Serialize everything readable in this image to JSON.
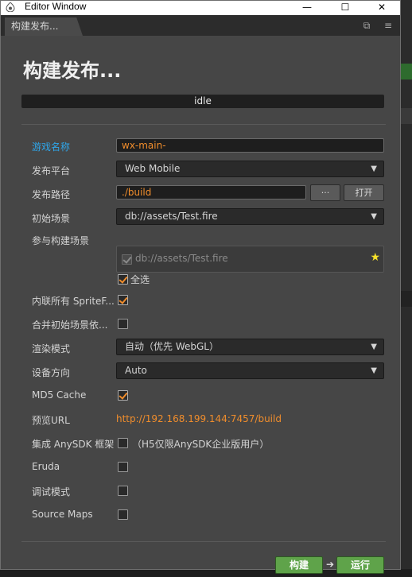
{
  "window": {
    "title": "Editor Window",
    "minimize": "—",
    "maximize": "☐",
    "close": "✕"
  },
  "tabs": [
    {
      "label": "构建发布..."
    }
  ],
  "tab_tools": {
    "popout_icon": "popout-icon",
    "menu_icon": "menu-icon"
  },
  "page": {
    "title": "构建发布...",
    "status": "idle"
  },
  "form": {
    "game_name": {
      "label": "游戏名称",
      "value": "wx-main-"
    },
    "platform": {
      "label": "发布平台",
      "value": "Web Mobile"
    },
    "build_path": {
      "label": "发布路径",
      "value": "./build",
      "browse_label": "···",
      "open_label": "打开"
    },
    "start_scene": {
      "label": "初始场景",
      "value": "db://assets/Test.fire"
    },
    "included_scenes": {
      "label": "参与构建场景",
      "scene": "db://assets/Test.fire",
      "select_all": "全选"
    },
    "inline_sprite_frames": {
      "label": "内联所有 SpriteF...",
      "checked": true
    },
    "merge_start_scene": {
      "label": "合并初始场景依...",
      "checked": false
    },
    "render_mode": {
      "label": "渲染模式",
      "value": "自动（优先 WebGL）"
    },
    "orientation": {
      "label": "设备方向",
      "value": "Auto"
    },
    "md5_cache": {
      "label": "MD5 Cache",
      "checked": true
    },
    "preview_url": {
      "label": "预览URL",
      "value": "http://192.168.199.144:7457/build"
    },
    "anysdk": {
      "label": "集成 AnySDK 框架",
      "note": "（H5仅限AnySDK企业版用户）",
      "checked": false
    },
    "eruda": {
      "label": "Eruda",
      "checked": false
    },
    "debug_mode": {
      "label": "调试模式",
      "checked": false
    },
    "source_maps": {
      "label": "Source Maps",
      "checked": false
    }
  },
  "actions": {
    "build": "构建",
    "arrow": "➔",
    "run": "运行"
  },
  "colors": {
    "accent": "#f08d2c",
    "active_label": "#2fa6ea",
    "button_green": "#5fa34a",
    "panel": "#464646"
  }
}
